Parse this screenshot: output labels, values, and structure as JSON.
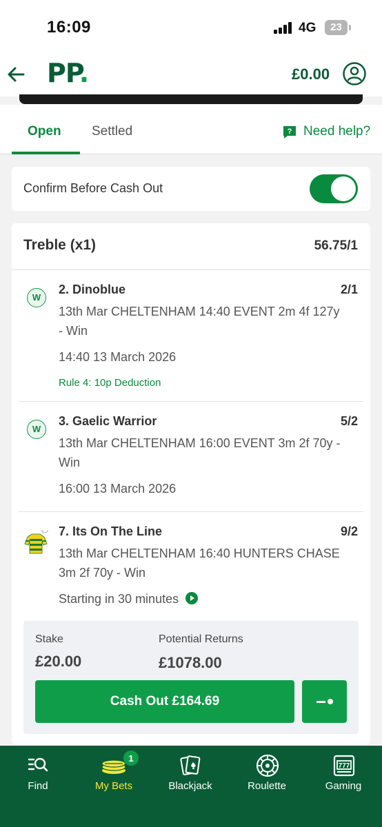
{
  "status_bar": {
    "time": "16:09",
    "network": "4G",
    "battery": "23"
  },
  "header": {
    "logo": "PP",
    "logo_dot": ".",
    "balance": "£0.00"
  },
  "tabs": {
    "open": "Open",
    "settled": "Settled",
    "help": "Need help?"
  },
  "confirm": {
    "label": "Confirm Before Cash Out",
    "enabled": true
  },
  "bet": {
    "type": "Treble (x1)",
    "odds": "56.75/1",
    "selections": [
      {
        "badge": "W",
        "name": "2. Dinoblue",
        "odds": "2/1",
        "description": "13th Mar CHELTENHAM 14:40 EVENT 2m 4f 127y - Win",
        "time": "14:40 13 March 2026",
        "rule": "Rule 4: 10p Deduction"
      },
      {
        "badge": "W",
        "name": "3. Gaelic Warrior",
        "odds": "5/2",
        "description": "13th Mar CHELTENHAM 16:00 EVENT 3m 2f 70y - Win",
        "time": "16:00 13 March 2026"
      },
      {
        "name": "7. Its On The Line",
        "odds": "9/2",
        "description": "13th Mar CHELTENHAM 16:40 HUNTERS CHASE 3m 2f 70y - Win",
        "time": "Starting in 30 minutes"
      }
    ],
    "stake_label": "Stake",
    "stake": "£20.00",
    "returns_label": "Potential Returns",
    "returns": "£1078.00",
    "cashout_label": "Cash Out £164.69"
  },
  "nav": {
    "items": [
      {
        "label": "Find",
        "icon": "search-list-icon"
      },
      {
        "label": "My Bets",
        "icon": "bets-stack-icon",
        "badge": "1",
        "active": true
      },
      {
        "label": "Blackjack",
        "icon": "cards-icon"
      },
      {
        "label": "Roulette",
        "icon": "roulette-icon"
      },
      {
        "label": "Gaming",
        "icon": "slot-machine-icon"
      }
    ]
  },
  "colors": {
    "brand_dark": "#0a5c36",
    "brand_green": "#0f9d4a",
    "active_nav": "#f5e63a"
  }
}
